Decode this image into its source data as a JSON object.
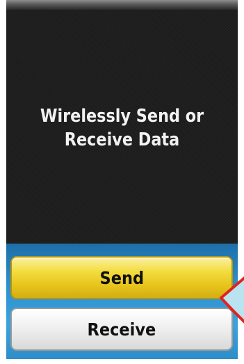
{
  "screen": {
    "message_line1": "Wirelessly Send or",
    "message_line2": "Receive Data"
  },
  "buttons": {
    "send_label": "Send",
    "receive_label": "Receive"
  },
  "colors": {
    "send_button": "#f0d43a",
    "receive_button": "#efefef",
    "panel_background": "#2c8fcf",
    "pointer_outline": "#e0231f",
    "pointer_fill": "#b9e3ef"
  },
  "icons": {
    "pointer": "red-arrow-pointer-icon"
  }
}
